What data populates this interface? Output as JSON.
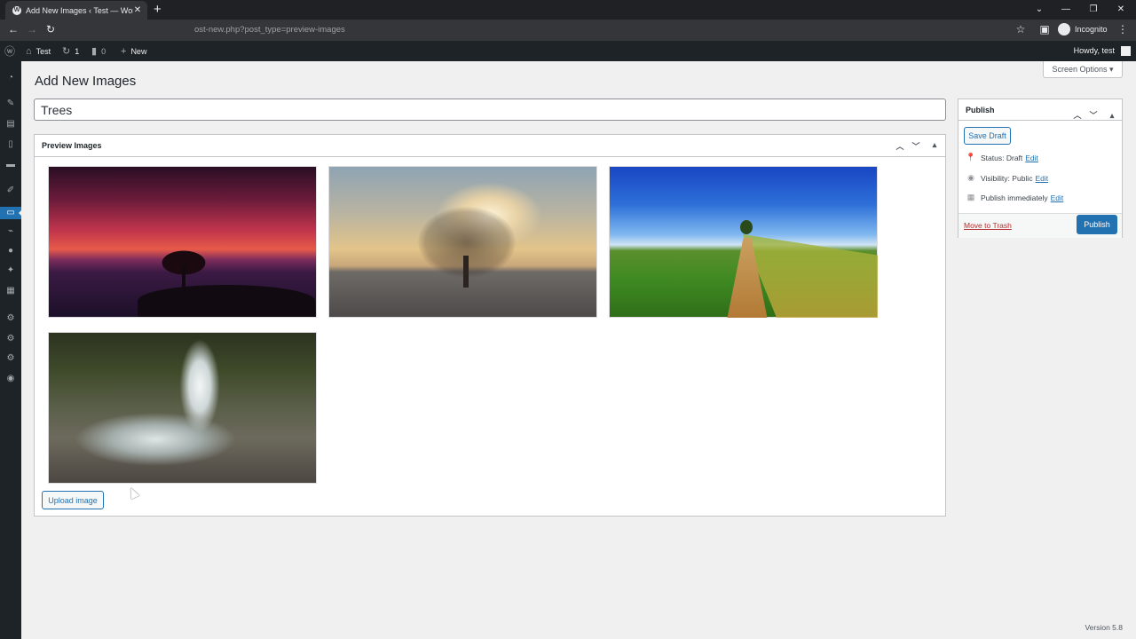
{
  "browser": {
    "tab_title": "Add New Images ‹ Test — WordPress",
    "new_tab": "+",
    "url": "ost-new.php?post_type=preview-images",
    "incognito_label": "Incognito"
  },
  "adminbar": {
    "site_name": "Test",
    "updates_count": "1",
    "comments_count": "0",
    "new_label": "New",
    "howdy": "Howdy, test"
  },
  "screen_options": "Screen Options ▾",
  "page_title": "Add New Images",
  "title_value": "Trees",
  "preview_box": {
    "title": "Preview Images",
    "images": [
      "Tree at sunset by the sea",
      "Tree in fog at sunrise",
      "Path through green fields",
      "Waterfall over rocks"
    ],
    "upload_label": "Upload image"
  },
  "publish_box": {
    "title": "Publish",
    "save_draft": "Save Draft",
    "status_label": "Status:",
    "status_value": "Draft",
    "visibility_label": "Visibility:",
    "visibility_value": "Public",
    "publish_label": "Publish",
    "publish_value": "immediately",
    "edit": "Edit",
    "trash": "Move to Trash",
    "publish_button": "Publish"
  },
  "version": "Version 5.8",
  "colors": {
    "accent": "#2271b1",
    "admin_bar": "#1d2327",
    "trash": "#b32d2e"
  }
}
